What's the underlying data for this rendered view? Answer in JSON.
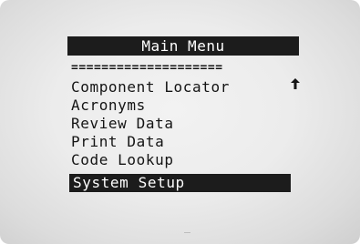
{
  "menu": {
    "title": "Main Menu",
    "divider": "====================",
    "items": [
      {
        "label": "Component Locator"
      },
      {
        "label": "Acronyms"
      },
      {
        "label": "Review Data"
      },
      {
        "label": "Print Data"
      },
      {
        "label": "Code Lookup"
      }
    ],
    "selected": {
      "label": "System Setup"
    },
    "scroll_indicator": "up-arrow-icon"
  },
  "colors": {
    "screen_background": "#ececec",
    "text": "#141414",
    "highlight": "#1c1c1c",
    "highlight_text": "#ffffff"
  }
}
